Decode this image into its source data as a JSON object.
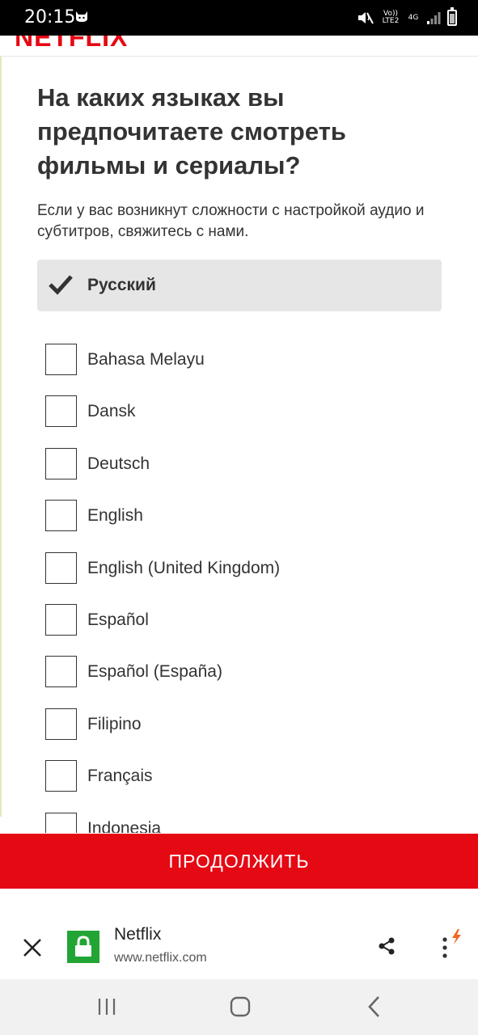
{
  "status_bar": {
    "time": "20:15",
    "volte_label": "Vo)) LTE2",
    "network_label": "4G"
  },
  "header": {
    "logo_text": "NETFLIX"
  },
  "page": {
    "title": "На каких языках вы предпочитаете смотреть фильмы и сериалы?",
    "subtitle": "Если у вас возникнут сложности с настройкой аудио и субтитров, свяжитесь с нами."
  },
  "selected_language": {
    "label": "Русский",
    "checked": true
  },
  "languages": [
    {
      "label": "Bahasa Melayu",
      "checked": false
    },
    {
      "label": "Dansk",
      "checked": false
    },
    {
      "label": "Deutsch",
      "checked": false
    },
    {
      "label": "English",
      "checked": false
    },
    {
      "label": "English (United Kingdom)",
      "checked": false
    },
    {
      "label": "Español",
      "checked": false
    },
    {
      "label": "Español (España)",
      "checked": false
    },
    {
      "label": "Filipino",
      "checked": false
    },
    {
      "label": "Français",
      "checked": false
    },
    {
      "label": "Indonesia",
      "checked": false
    }
  ],
  "continue_button": {
    "label": "ПРОДОЛЖИТЬ"
  },
  "browser_bar": {
    "site_name": "Netflix",
    "site_url": "www.netflix.com"
  },
  "colors": {
    "brand_red": "#e50914",
    "lock_green": "#22a534",
    "selected_bg": "#e6e6e6"
  },
  "icons": [
    "cat-notification-icon",
    "mute-icon",
    "signal-icon",
    "battery-icon",
    "check-icon",
    "close-icon",
    "lock-icon",
    "share-icon",
    "more-menu-icon",
    "recents-icon",
    "home-icon",
    "back-icon"
  ]
}
